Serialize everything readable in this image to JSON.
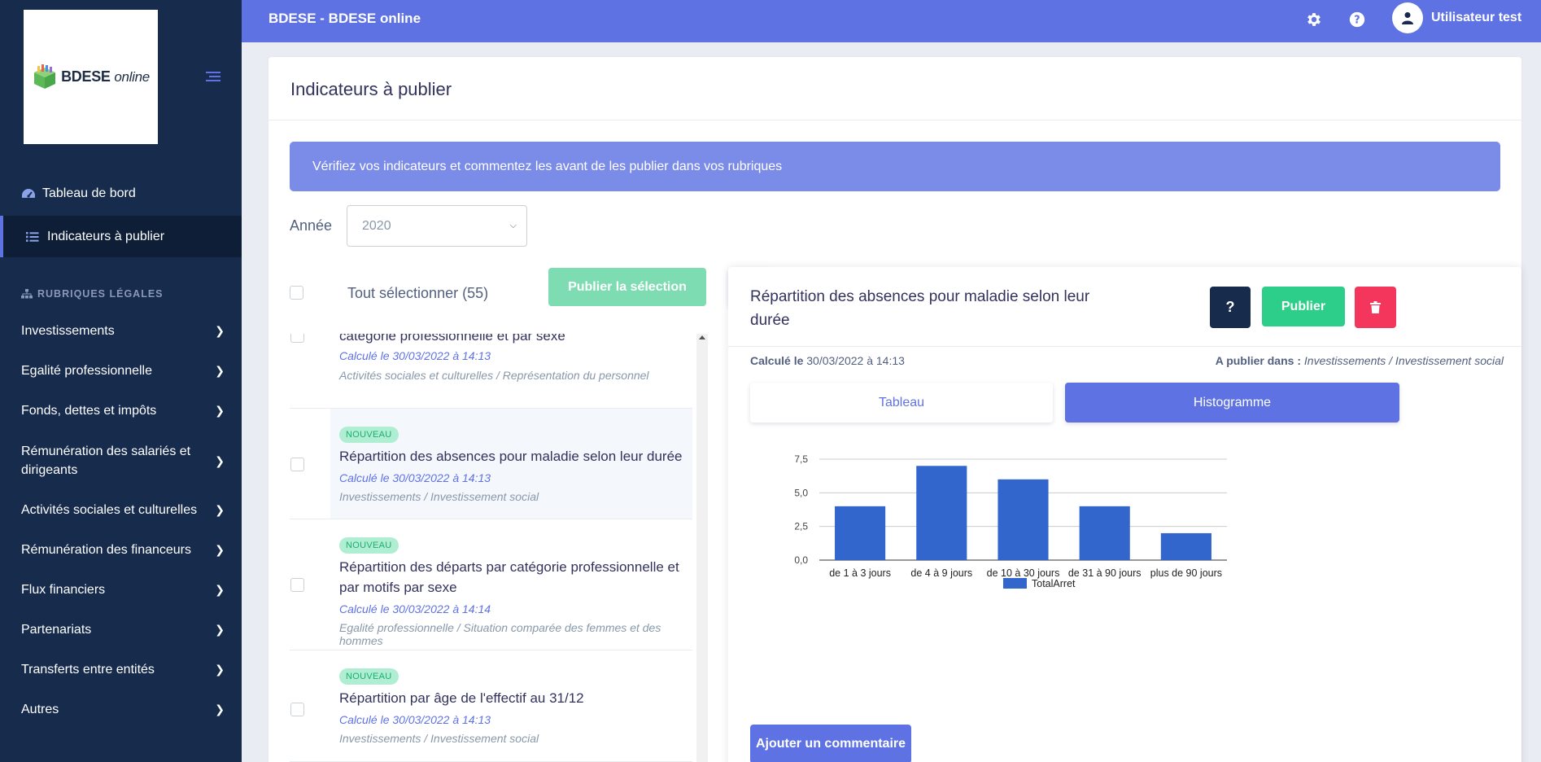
{
  "sidebar": {
    "logo": {
      "brand": "BDESE",
      "suffix": "online"
    },
    "nav": [
      {
        "label": "Tableau de bord",
        "icon": "dashboard-icon",
        "active": false
      },
      {
        "label": "Indicateurs à publier",
        "icon": "list-icon",
        "active": true
      }
    ],
    "section_title": "RUBRIQUES LÉGALES",
    "rubriques": [
      "Investissements",
      "Egalité professionnelle",
      "Fonds, dettes et impôts",
      "Rémunération des salariés et dirigeants",
      "Activités sociales et culturelles",
      "Rémunération des financeurs",
      "Flux financiers",
      "Partenariats",
      "Transferts entre entités",
      "Autres"
    ]
  },
  "topbar": {
    "title": "BDESE - BDESE online",
    "user_name": "Utilisateur test"
  },
  "main": {
    "title": "Indicateurs à publier",
    "alert": "Vérifiez vos indicateurs et commentez les avant de les publier dans vos rubriques",
    "year_label": "Année",
    "year_value": "2020",
    "select_all": "Tout sélectionner (55)",
    "publish_selection": "Publier la sélection"
  },
  "list": [
    {
      "badge": "",
      "title": "catégorie professionnelle et par sexe",
      "calc": "Calculé le 30/03/2022 à 14:13",
      "path": "Activités sociales et culturelles / Représentation du personnel",
      "selected": false
    },
    {
      "badge": "NOUVEAU",
      "title": "Répartition des absences pour maladie selon leur durée",
      "calc": "Calculé le 30/03/2022 à 14:13",
      "path": "Investissements / Investissement social",
      "selected": true
    },
    {
      "badge": "NOUVEAU",
      "title": "Répartition des départs par catégorie professionnelle et par motifs par sexe",
      "calc": "Calculé le 30/03/2022 à 14:14",
      "path": "Egalité professionnelle / Situation comparée des femmes et des hommes",
      "selected": false
    },
    {
      "badge": "NOUVEAU",
      "title": "Répartition par âge de l'effectif au 31/12",
      "calc": "Calculé le 30/03/2022 à 14:13",
      "path": "Investissements / Investissement social",
      "selected": false
    }
  ],
  "detail": {
    "title": "Répartition des absences pour maladie selon leur durée",
    "help_label": "?",
    "publish_label": "Publier",
    "calc_prefix": "Calculé le",
    "calc_value": "30/03/2022 à 14:13",
    "publish_in_prefix": "A publier dans :",
    "publish_in_value": "Investissements / Investissement social",
    "tab_table": "Tableau",
    "tab_histogram": "Histogramme",
    "add_comment": "Ajouter un commentaire"
  },
  "chart_data": {
    "type": "bar",
    "categories": [
      "de 1 à 3 jours",
      "de 4 à 9 jours",
      "de 10 à 30 jours",
      "de 31 à 90 jours",
      "plus de 90 jours"
    ],
    "series": [
      {
        "name": "TotalArret",
        "values": [
          4,
          7,
          6,
          4,
          2
        ],
        "color": "#3366cc"
      }
    ],
    "yticks": [
      "0,0",
      "2,5",
      "5,0",
      "7,5"
    ],
    "ylim": [
      0,
      7.5
    ],
    "grid": true,
    "legend": "bottom"
  },
  "colors": {
    "primary": "#5e72e4",
    "sidebar": "#172b4d",
    "success": "#2dce89",
    "danger": "#f5365c",
    "bar": "#3366cc"
  }
}
